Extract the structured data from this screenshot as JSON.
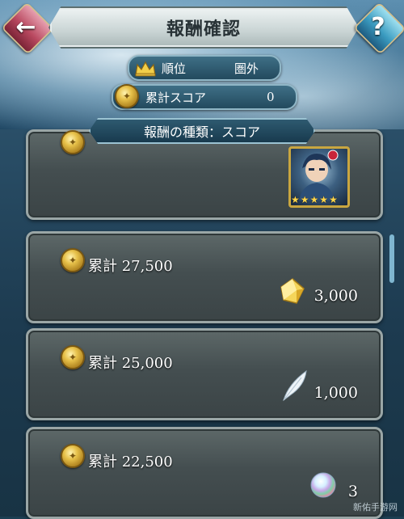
{
  "header": {
    "title": "報酬確認",
    "back_icon": "←",
    "help_icon": "?"
  },
  "rank": {
    "label": "順位",
    "value": "圏外"
  },
  "score": {
    "label": "累計スコア",
    "value": "0"
  },
  "category": {
    "label": "報酬の種類：スコア"
  },
  "rewards": [
    {
      "label": "",
      "amount": "",
      "icon": "hero-portrait-icon"
    },
    {
      "label": "累計 27,500",
      "amount": "3,000",
      "icon": "gold-crystal-icon"
    },
    {
      "label": "累計 25,000",
      "amount": "1,000",
      "icon": "feather-icon"
    },
    {
      "label": "累計 22,500",
      "amount": "3",
      "icon": "orb-icon"
    }
  ],
  "watermark": "新佑手游网",
  "colors": {
    "accent": "#9bc3d2",
    "coin": "#e7c14a",
    "back_button": "#b8485f",
    "help_button": "#3a9bc0"
  }
}
